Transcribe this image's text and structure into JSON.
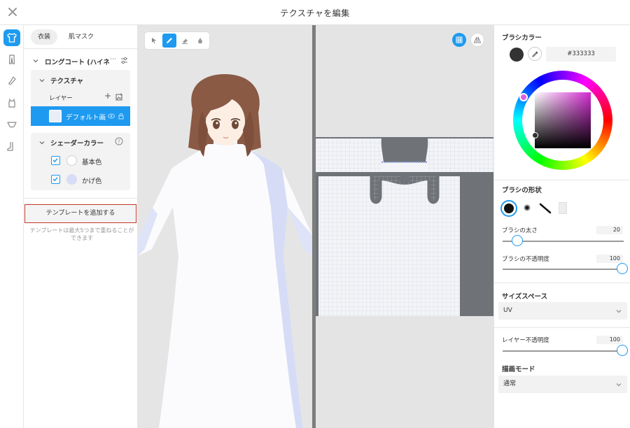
{
  "header": {
    "title": "テクスチャを編集"
  },
  "rail": {
    "icons": [
      "shirt-icon",
      "pants-icon",
      "sock-icon",
      "tank-top-icon",
      "underwear-icon",
      "shoe-icon"
    ]
  },
  "left": {
    "tabs": [
      "衣装",
      "肌マスク"
    ],
    "item_title": "ロングコート (ハイネ",
    "texture_label": "テクスチャ",
    "layer_label": "レイヤー",
    "layer_name": "デフォルト画",
    "shader_label": "シェーダーカラー",
    "shader_items": [
      {
        "label": "基本色",
        "color": "#ffffff"
      },
      {
        "label": "かげ色",
        "color": "#d7dcf7"
      }
    ],
    "add_template_label": "テンプレートを追加する",
    "template_note": "テンプレートは最大5つまで重ねることができます"
  },
  "viewport": {
    "tools": [
      "select-arrow-icon",
      "pen-icon",
      "eraser-icon",
      "fill-drop-icon"
    ],
    "active_tool": 1
  },
  "right": {
    "brush_color_label": "ブラシカラー",
    "brush_color_hex": "#333333",
    "brush_color": "#333333",
    "brush_shape_label": "ブラシの形状",
    "brush_size_label": "ブラシの太さ",
    "brush_size_value": "20",
    "brush_size_fraction": 0.12,
    "brush_opacity_label": "ブラシの不透明度",
    "brush_opacity_value": "100",
    "brush_opacity_fraction": 1.0,
    "size_space_label": "サイズスペース",
    "size_space_value": "UV",
    "layer_opacity_label": "レイヤー不透明度",
    "layer_opacity_value": "100",
    "layer_opacity_fraction": 1.0,
    "blend_mode_label": "描画モード",
    "blend_mode_value": "通常",
    "accent": "#1e9af0"
  }
}
